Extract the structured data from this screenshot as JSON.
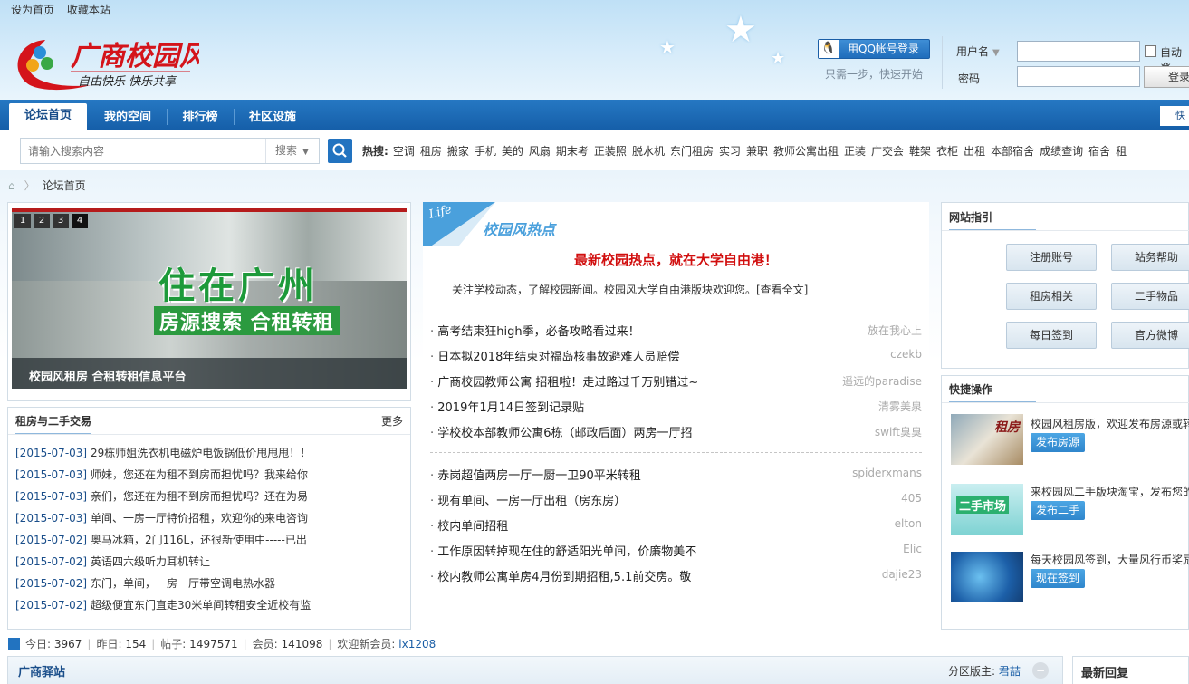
{
  "topbar": {
    "set_home": "设为首页",
    "bookmark": "收藏本站"
  },
  "logo": {
    "name": "广商校园风",
    "slogan": "自由快乐 快乐共享"
  },
  "login": {
    "qq_button": "用QQ帐号登录",
    "qq_hint": "只需一步，快速开始",
    "user_label": "用户名",
    "password_label": "密码",
    "auto_login": "自动登",
    "login_button": "登录"
  },
  "nav": {
    "items": [
      "论坛首页",
      "我的空间",
      "排行榜",
      "社区设施"
    ],
    "right_partial": "快"
  },
  "search": {
    "placeholder": "请输入搜索内容",
    "type": "搜索",
    "hot_label": "热搜:",
    "hot_terms": [
      "空调",
      "租房",
      "搬家",
      "手机",
      "美的",
      "风扇",
      "期末考",
      "正装照",
      "脱水机",
      "东门租房",
      "实习",
      "兼职",
      "教师公寓出租",
      "正装",
      "广交会",
      "鞋架",
      "衣柜",
      "出租",
      "本部宿舍",
      "成绩查询",
      "宿舍",
      "租"
    ]
  },
  "breadcrumb": {
    "home": "论坛首页"
  },
  "slider": {
    "dots": [
      "1",
      "2",
      "3",
      "4"
    ],
    "big_text": "住在广州",
    "sub_text": "房源搜索 合租转租",
    "caption": "校园风租房 合租转租信息平台"
  },
  "rent": {
    "title": "租房与二手交易",
    "more": "更多",
    "items": [
      {
        "date": "[2015-07-03]",
        "text": "29栋师姐洗衣机电磁炉电饭锅低价甩甩甩！！"
      },
      {
        "date": "[2015-07-03]",
        "text": "师妹，您还在为租不到房而担忧吗？我来给你"
      },
      {
        "date": "[2015-07-03]",
        "text": "亲们，您还在为租不到房而担忧吗？还在为易"
      },
      {
        "date": "[2015-07-03]",
        "text": "单间、一房一厅特价招租，欢迎你的来电咨询"
      },
      {
        "date": "[2015-07-02]",
        "text": "奥马冰箱，2门116L，还很新使用中-----已出"
      },
      {
        "date": "[2015-07-02]",
        "text": "英语四六级听力耳机转让"
      },
      {
        "date": "[2015-07-02]",
        "text": "东门，单间，一房一厅带空调电热水器"
      },
      {
        "date": "[2015-07-02]",
        "text": "超级便宜东门直走30米单间转租安全近校有监"
      }
    ]
  },
  "stats": {
    "today_label": "今日:",
    "today": "3967",
    "yesterday_label": "昨日:",
    "yesterday": "154",
    "posts_label": "帖子:",
    "posts": "1497571",
    "members_label": "会员:",
    "members": "141098",
    "welcome_label": "欢迎新会员:",
    "newest": "lx1208"
  },
  "hotspot": {
    "life": "Life",
    "title": "校园风热点",
    "headline": "最新校园热点，就在大学自由港！",
    "desc": "关注学校动态，了解校园新闻。校园风大学自由港版块欢迎您。[查看全文]",
    "group1": [
      {
        "title": "高考结束狂high季，必备攻略看过来！",
        "author": "放在我心上"
      },
      {
        "title": "日本拟2018年结束对福岛核事故避难人员赔偿",
        "author": "czekb"
      },
      {
        "title": "广商校园教师公寓 招租啦！走过路过千万别错过~",
        "author": "遥远的paradise"
      },
      {
        "title": "2019年1月14日签到记录贴",
        "author": "清雾美泉"
      },
      {
        "title": "学校校本部教师公寓6栋（邮政后面）两房一厅招",
        "author": "swift臭臭"
      }
    ],
    "group2": [
      {
        "title": "赤岗超值两房一厅一厨一卫90平米转租",
        "author": "spiderxmans"
      },
      {
        "title": "现有单间、一房一厅出租（房东房）",
        "author": "405"
      },
      {
        "title": "校内单间招租",
        "author": "elton"
      },
      {
        "title": "工作原因转掉现在住的舒适阳光单间，价廉物美不",
        "author": "Elic"
      },
      {
        "title": "校内教师公寓单房4月份到期招租,5.1前交房。敬",
        "author": "dajie23"
      }
    ]
  },
  "guide": {
    "title": "网站指引",
    "buttons": [
      "注册账号",
      "站务帮助",
      "租房相关",
      "二手物品",
      "每日签到",
      "官方微博"
    ]
  },
  "quick": {
    "title": "快捷操作",
    "items": [
      {
        "img_label": "租房",
        "text": "校园风租房版，欢迎发布房源或转",
        "button": "发布房源"
      },
      {
        "img_label": "二手市场",
        "text": "来校园风二手版块淘宝，发布您的",
        "button": "发布二手"
      },
      {
        "img_label": "",
        "text": "每天校园风签到，大量风行币奖励",
        "button": "现在签到"
      }
    ]
  },
  "zone": {
    "title": "广商驿站",
    "mod_label": "分区版主:",
    "mod": "君喆",
    "toggle": "−"
  },
  "latest": {
    "title": "最新回复"
  },
  "colors": {
    "nav": "#1f6dbb",
    "accent": "#2273c0",
    "headline": "#d10e0e",
    "hot_title": "#4aa0dc"
  }
}
